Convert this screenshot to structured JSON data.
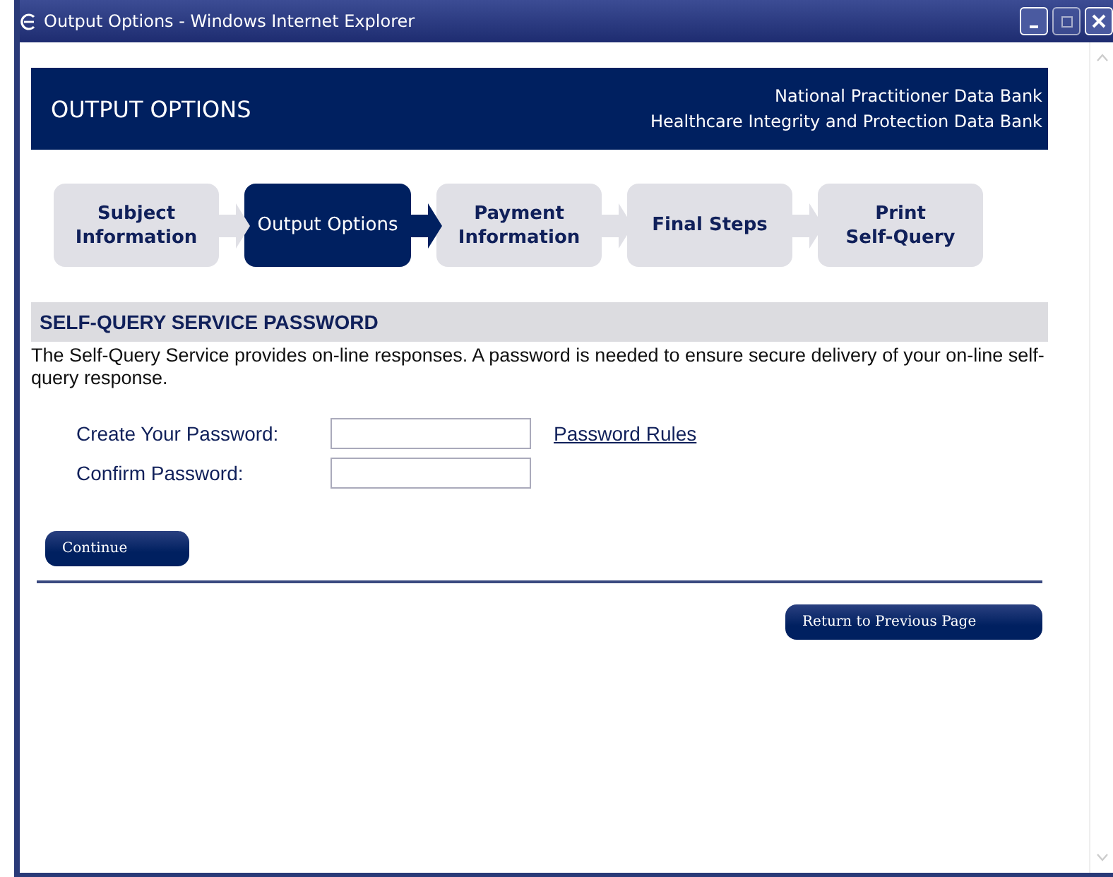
{
  "window": {
    "title": "Output Options - Windows Internet Explorer"
  },
  "header": {
    "title": "OUTPUT OPTIONS",
    "org_lines": [
      "National Practitioner Data Bank",
      "Healthcare Integrity and Protection Data Bank"
    ]
  },
  "steps": [
    {
      "label": "Subject Information",
      "selected": false
    },
    {
      "label": "Output Options",
      "selected": true
    },
    {
      "label": "Payment Information",
      "selected": false
    },
    {
      "label": "Final Steps",
      "selected": false
    },
    {
      "label": "Print Self-Query",
      "selected": false
    }
  ],
  "section": {
    "title": "SELF-QUERY SERVICE PASSWORD",
    "description": "The Self-Query Service provides on-line responses. A password is needed to ensure secure delivery of your on-line self-query response."
  },
  "fields": [
    {
      "label": "Create Your Password:",
      "link": "Password Rules"
    },
    {
      "label": "Confirm Password:"
    }
  ],
  "buttons": {
    "continue": "Continue",
    "back": "Return to Previous Page"
  }
}
